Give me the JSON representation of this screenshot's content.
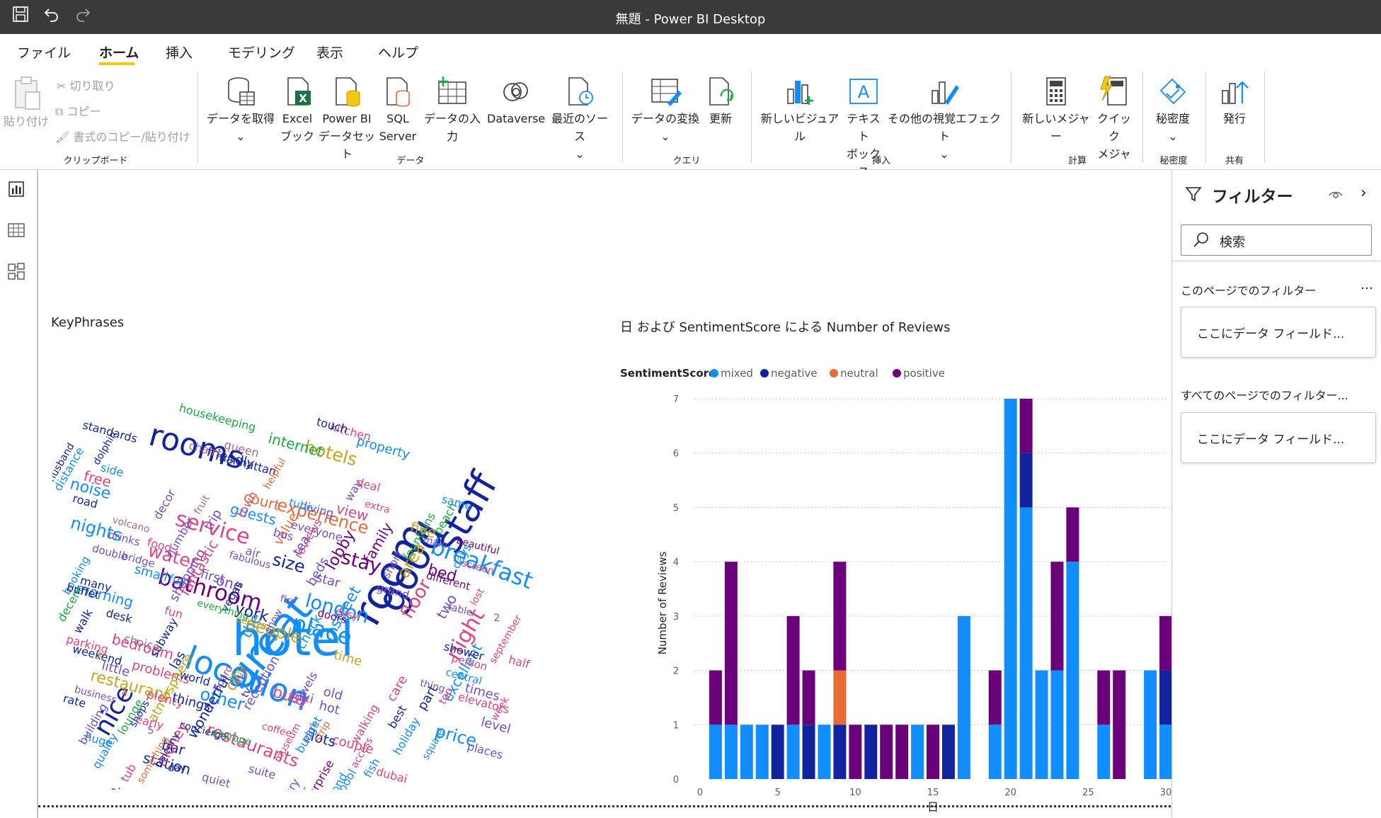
{
  "app": {
    "title": "無題 - Power BI Desktop"
  },
  "menu": {
    "items": [
      "ファイル",
      "ホーム",
      "挿入",
      "モデリング",
      "表示",
      "ヘルプ"
    ],
    "active": "ホーム"
  },
  "ribbon": {
    "clipboard": {
      "paste": "貼り付け",
      "cut": "切り取り",
      "copy": "コピー",
      "format": "書式のコピー/貼り付け",
      "group": "クリップボード"
    },
    "data": {
      "get": "データを取得",
      "excel1": "Excel",
      "excel2": "ブック",
      "pbi1": "Power BI",
      "pbi2": "データセット",
      "sql1": "SQL",
      "sql2": "Server",
      "enter": "データの入力",
      "dataverse": "Dataverse",
      "recent": "最近のソース",
      "group": "データ"
    },
    "query": {
      "transform": "データの変換",
      "refresh": "更新",
      "group": "クエリ"
    },
    "insert": {
      "visual": "新しいビジュアル",
      "text1": "テキスト",
      "text2": "ボックス",
      "more": "その他の視覚エフェクト",
      "group": "挿入"
    },
    "calc": {
      "measure": "新しいメジャー",
      "quick1": "クイック",
      "quick2": "メジャー",
      "group": "計算"
    },
    "sensitivity": {
      "label": "秘密度",
      "group": "秘密度"
    },
    "share": {
      "publish": "発行",
      "group": "共有"
    }
  },
  "filters": {
    "title": "フィルター",
    "search_placeholder": "検索",
    "this_page": "このページでのフィルター",
    "all_pages": "すべてのページでのフィルター...",
    "well_text": "ここにデータ フィールド..."
  },
  "wordcloud": {
    "title": "KeyPhrases",
    "words": [
      {
        "w": "hotel",
        "c": "#118dff"
      },
      {
        "w": "room",
        "c": "#12239e"
      },
      {
        "w": "great",
        "c": "#118dff"
      },
      {
        "w": "location",
        "c": "#118dff"
      },
      {
        "w": "staff",
        "c": "#12239e"
      },
      {
        "w": "good",
        "c": "#12239e"
      },
      {
        "w": "rooms",
        "c": "#12239e"
      },
      {
        "w": "breakfast",
        "c": "#118dff"
      },
      {
        "w": "service",
        "c": "#e04480"
      },
      {
        "w": "bathroom",
        "c": "#6b007b"
      },
      {
        "w": "nice",
        "c": "#12239e"
      },
      {
        "w": "place",
        "c": "#118dff"
      },
      {
        "w": "restaurants",
        "c": "#e04480"
      },
      {
        "w": "london",
        "c": "#118dff"
      },
      {
        "w": "hotels",
        "c": "#c8a41d"
      },
      {
        "w": "experience",
        "c": "#e66c37"
      },
      {
        "w": "stay",
        "c": "#6b007b"
      },
      {
        "w": "night",
        "c": "#e04480"
      },
      {
        "w": "people",
        "c": "#c8a41d"
      },
      {
        "w": "floor",
        "c": "#e04480"
      },
      {
        "w": "water",
        "c": "#e04480"
      },
      {
        "w": "size",
        "c": "#12239e"
      },
      {
        "w": "noise",
        "c": "#118dff"
      },
      {
        "w": "nights",
        "c": "#118dff"
      },
      {
        "w": "area",
        "c": "#c8a41d"
      },
      {
        "w": "other",
        "c": "#118dff"
      },
      {
        "w": "price",
        "c": "#118dff"
      },
      {
        "w": "restaurant",
        "c": "#c8a41d"
      },
      {
        "w": "internet",
        "c": "#1aab40"
      },
      {
        "w": "housekeeping",
        "c": "#1aab40"
      },
      {
        "w": "bed",
        "c": "#6b007b"
      },
      {
        "w": "lobby",
        "c": "#6b007b"
      },
      {
        "w": "street",
        "c": "#118dff"
      },
      {
        "w": "york",
        "c": "#12239e"
      },
      {
        "w": "lots",
        "c": "#12239e"
      },
      {
        "w": "station",
        "c": "#12239e"
      },
      {
        "w": "bar",
        "c": "#12239e"
      },
      {
        "w": "money",
        "c": "#e04480"
      },
      {
        "w": "bedroom",
        "c": "#e04480"
      },
      {
        "w": "morning",
        "c": "#118dff"
      },
      {
        "w": "guests",
        "c": "#118dff"
      },
      {
        "w": "town",
        "c": "#e04480"
      },
      {
        "w": "city",
        "c": "#c8a41d"
      },
      {
        "w": "couple",
        "c": "#e04480"
      },
      {
        "w": "time",
        "c": "#c8a41d"
      },
      {
        "w": "excellent",
        "c": "#118dff"
      },
      {
        "w": "fountains",
        "c": "#1aab40"
      },
      {
        "w": "beach",
        "c": "#1aab40"
      },
      {
        "w": "free",
        "c": "#e04480"
      },
      {
        "w": "standards",
        "c": "#12239e"
      },
      {
        "w": "friendly",
        "c": "#12239e"
      },
      {
        "w": "manhattan",
        "c": "#12239e"
      },
      {
        "w": "property",
        "c": "#118dff"
      },
      {
        "w": "kitchen",
        "c": "#e04480"
      },
      {
        "w": "touch",
        "c": "#12239e"
      },
      {
        "w": "queen",
        "c": "#a66999"
      },
      {
        "w": "chairs",
        "c": "#a66999"
      },
      {
        "w": "helpful",
        "c": "#e66c37"
      },
      {
        "w": "side",
        "c": "#118dff"
      },
      {
        "w": "road",
        "c": "#12239e"
      },
      {
        "w": "distance",
        "c": "#118dff"
      },
      {
        "w": "husband",
        "c": "#12239e"
      },
      {
        "w": "dolphin",
        "c": "#12239e"
      },
      {
        "w": "decor",
        "c": "#744ec2"
      },
      {
        "w": "number",
        "c": "#744ec2"
      },
      {
        "w": "fruit",
        "c": "#a66999"
      },
      {
        "w": "trip",
        "c": "#744ec2"
      },
      {
        "w": "volcano",
        "c": "#a66999"
      },
      {
        "w": "drinks",
        "c": "#744ec2"
      },
      {
        "w": "booking",
        "c": "#118dff"
      },
      {
        "w": "food",
        "c": "#e04480"
      },
      {
        "w": "double",
        "c": "#744ec2"
      },
      {
        "w": "bridge",
        "c": "#744ec2"
      },
      {
        "w": "shopping",
        "c": "#744ec2"
      },
      {
        "w": "fantastic",
        "c": "#e04480"
      },
      {
        "w": "first",
        "c": "#744ec2"
      },
      {
        "w": "air",
        "c": "#744ec2"
      },
      {
        "w": "fabulous",
        "c": "#744ec2"
      },
      {
        "w": "value",
        "c": "#e66c37"
      },
      {
        "w": "living",
        "c": "#744ec2"
      },
      {
        "w": "everyone",
        "c": "#744ec2"
      },
      {
        "w": "view",
        "c": "#e04480"
      },
      {
        "w": "way",
        "c": "#744ec2"
      },
      {
        "w": "deal",
        "c": "#e04480"
      },
      {
        "w": "extra",
        "c": "#e04480"
      },
      {
        "w": "family",
        "c": "#6b007b"
      },
      {
        "w": "same",
        "c": "#118dff"
      },
      {
        "w": "days",
        "c": "#118dff"
      },
      {
        "w": "main",
        "c": "#744ec2"
      },
      {
        "w": "beautiful",
        "c": "#6b007b"
      },
      {
        "w": "screen",
        "c": "#e04480"
      },
      {
        "w": "lost",
        "c": "#e04480"
      },
      {
        "w": "different",
        "c": "#6b007b"
      },
      {
        "w": "table",
        "c": "#744ec2"
      },
      {
        "w": "september",
        "c": "#e04480"
      },
      {
        "w": "two",
        "c": "#744ec2"
      },
      {
        "w": "grand",
        "c": "#744ec2"
      },
      {
        "w": "short",
        "c": "#744ec2"
      },
      {
        "w": "decent",
        "c": "#1aab40"
      },
      {
        "w": "buffet",
        "c": "#12239e"
      },
      {
        "w": "many",
        "c": "#12239e"
      },
      {
        "w": "small",
        "c": "#118dff"
      },
      {
        "w": "full",
        "c": "#118dff"
      },
      {
        "w": "one",
        "c": "#744ec2"
      },
      {
        "w": "walk",
        "c": "#12239e"
      },
      {
        "w": "desk",
        "c": "#12239e"
      },
      {
        "w": "fun",
        "c": "#e04480"
      },
      {
        "w": "vegas",
        "c": "#12239e"
      },
      {
        "w": "the",
        "c": "#118dff"
      },
      {
        "w": "fire",
        "c": "#744ec2"
      },
      {
        "w": "show",
        "c": "#744ec2"
      },
      {
        "w": "beds",
        "c": "#744ec2"
      },
      {
        "w": "star",
        "c": "#744ec2"
      },
      {
        "w": "easy",
        "c": "#e04480"
      },
      {
        "w": "doors",
        "c": "#6b007b"
      },
      {
        "w": "check",
        "c": "#118dff"
      },
      {
        "w": "subway",
        "c": "#12239e"
      },
      {
        "w": "everything",
        "c": "#1aab40"
      },
      {
        "w": "centre",
        "c": "#c8a41d"
      },
      {
        "w": "towels",
        "c": "#744ec2"
      },
      {
        "w": "park",
        "c": "#744ec2"
      },
      {
        "w": "strip",
        "c": "#e66c37"
      },
      {
        "w": "care",
        "c": "#e04480"
      },
      {
        "w": "shower",
        "c": "#12239e"
      },
      {
        "w": "half",
        "c": "#e04480"
      },
      {
        "w": "person",
        "c": "#e04480"
      },
      {
        "w": "central",
        "c": "#118dff"
      },
      {
        "w": "times",
        "c": "#744ec2"
      },
      {
        "w": "elevators",
        "c": "#e04480"
      },
      {
        "w": "thing",
        "c": "#744ec2"
      },
      {
        "w": "parking",
        "c": "#e04480"
      },
      {
        "w": "weekend",
        "c": "#12239e"
      },
      {
        "w": "choice",
        "c": "#a66999"
      },
      {
        "w": "las",
        "c": "#12239e"
      },
      {
        "w": "little",
        "c": "#744ec2"
      },
      {
        "w": "problems",
        "c": "#e04480"
      },
      {
        "w": "world",
        "c": "#12239e"
      },
      {
        "w": "business",
        "c": "#744ec2"
      },
      {
        "w": "atmosphere",
        "c": "#c8a41d"
      },
      {
        "w": "plenty",
        "c": "#e04480"
      },
      {
        "w": "rate",
        "c": "#12239e"
      },
      {
        "w": "early",
        "c": "#e04480"
      },
      {
        "w": "huge",
        "c": "#118dff"
      },
      {
        "w": "building",
        "c": "#744ec2"
      },
      {
        "w": "lounge",
        "c": "#1aab40"
      },
      {
        "w": "shops",
        "c": "#12239e"
      },
      {
        "w": "things",
        "c": "#12239e"
      },
      {
        "w": "wonderful",
        "c": "#12239e"
      },
      {
        "w": "board",
        "c": "#744ec2"
      },
      {
        "w": "mix",
        "c": "#744ec2"
      },
      {
        "w": "tv",
        "c": "#12239e"
      },
      {
        "w": "reception",
        "c": "#744ec2"
      },
      {
        "w": "taxi",
        "c": "#744ec2"
      },
      {
        "w": "hot",
        "c": "#744ec2"
      },
      {
        "w": "old",
        "c": "#744ec2"
      },
      {
        "w": "walking",
        "c": "#e04480"
      },
      {
        "w": "best",
        "c": "#12239e"
      },
      {
        "w": "part",
        "c": "#12239e"
      },
      {
        "w": "top",
        "c": "#e04480"
      },
      {
        "w": "level",
        "c": "#744ec2"
      },
      {
        "w": "week",
        "c": "#e04480"
      },
      {
        "w": "places",
        "c": "#744ec2"
      },
      {
        "w": "holiday",
        "c": "#118dff"
      },
      {
        "w": "square",
        "c": "#118dff"
      },
      {
        "w": "dubai",
        "c": "#e04480"
      },
      {
        "w": "fish",
        "c": "#118dff"
      },
      {
        "w": "access",
        "c": "#e04480"
      },
      {
        "w": "second",
        "c": "#118dff"
      },
      {
        "w": "pool",
        "c": "#118dff"
      },
      {
        "w": "surprise",
        "c": "#6b007b"
      },
      {
        "w": "budget",
        "c": "#118dff"
      },
      {
        "w": "coffee",
        "c": "#e04480"
      },
      {
        "w": "museum",
        "c": "#e04480"
      },
      {
        "w": "music",
        "c": "#1aab40"
      },
      {
        "w": "luxury",
        "c": "#744ec2"
      },
      {
        "w": "suite",
        "c": "#744ec2"
      },
      {
        "w": "last",
        "c": "#c8a41d"
      },
      {
        "w": "quiet",
        "c": "#744ec2"
      },
      {
        "w": "years",
        "c": "#744ec2"
      },
      {
        "w": "advisor",
        "c": "#12239e"
      },
      {
        "w": "airport",
        "c": "#12239e"
      },
      {
        "w": "tub",
        "c": "#e04480"
      },
      {
        "w": "quality",
        "c": "#118dff"
      },
      {
        "w": "something",
        "c": "#e66c37"
      },
      {
        "w": "balcony",
        "c": "#12239e"
      },
      {
        "w": "concierge",
        "c": "#12239e"
      },
      {
        "w": "average",
        "c": "#1aab40"
      },
      {
        "w": "reviews",
        "c": "#e04480"
      },
      {
        "w": "tea",
        "c": "#744ec2"
      },
      {
        "w": "busy",
        "c": "#e04480"
      },
      {
        "w": "five",
        "c": "#c8a41d"
      },
      {
        "w": "bus",
        "c": "#744ec2"
      },
      {
        "w": "court",
        "c": "#e66c37"
      },
      {
        "w": "tube",
        "c": "#118dff"
      },
      {
        "w": "2",
        "c": "#744ec2"
      },
      {
        "w": "3",
        "c": "#c8a41d"
      },
      {
        "w": "4",
        "c": "#e66c37"
      },
      {
        "w": "5",
        "c": "#744ec2"
      },
      {
        "w": "day",
        "c": "#12239e"
      }
    ]
  },
  "chart_data": {
    "type": "bar",
    "stacked": true,
    "title": "日 および SentimentScore による Number of Reviews",
    "legend_title": "SentimentScore",
    "xlabel": "日",
    "ylabel": "Number of Reviews",
    "ylim": [
      0,
      7
    ],
    "yticks": [
      0,
      1,
      2,
      3,
      4,
      5,
      6,
      7
    ],
    "xticks": [
      0,
      5,
      10,
      15,
      20,
      25,
      30
    ],
    "categories": [
      1,
      2,
      3,
      4,
      5,
      6,
      7,
      8,
      9,
      10,
      11,
      12,
      13,
      14,
      15,
      16,
      17,
      18,
      19,
      20,
      21,
      22,
      23,
      24,
      25,
      26,
      27,
      28,
      29,
      30
    ],
    "series": [
      {
        "name": "mixed",
        "color": "#118dff",
        "values": [
          1,
          1,
          1,
          1,
          0,
          1,
          0,
          1,
          0,
          0,
          0,
          0,
          0,
          1,
          0,
          0,
          3,
          0,
          1,
          7,
          5,
          2,
          2,
          4,
          0,
          1,
          0,
          0,
          2,
          1,
          1
        ]
      },
      {
        "name": "negative",
        "color": "#12239e",
        "values": [
          0,
          0,
          0,
          0,
          1,
          0,
          1,
          0,
          1,
          0,
          1,
          0,
          0,
          0,
          0,
          1,
          0,
          0,
          0,
          0,
          1,
          0,
          0,
          0,
          0,
          0,
          0,
          0,
          0,
          1,
          0
        ]
      },
      {
        "name": "neutral",
        "color": "#e66c37",
        "values": [
          0,
          0,
          0,
          0,
          0,
          0,
          0,
          0,
          1,
          0,
          0,
          0,
          0,
          0,
          0,
          0,
          0,
          0,
          0,
          0,
          0,
          0,
          0,
          0,
          0,
          0,
          0,
          0,
          0,
          0,
          0
        ]
      },
      {
        "name": "positive",
        "color": "#6b007b",
        "values": [
          1,
          3,
          0,
          0,
          0,
          2,
          1,
          0,
          2,
          1,
          0,
          1,
          1,
          0,
          1,
          0,
          0,
          0,
          1,
          0,
          1,
          0,
          2,
          1,
          0,
          1,
          2,
          0,
          0,
          1,
          1
        ]
      }
    ],
    "grid": true,
    "legend_position": "top-left"
  }
}
